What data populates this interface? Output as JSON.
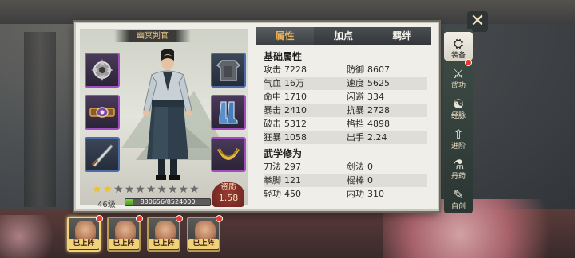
{
  "character": {
    "title": "幽冥判官",
    "level": "46级",
    "exp_text": "830656/8524000",
    "exp_fraction": 0.097,
    "stars_total": 10,
    "stars_on": 2,
    "aptitude_label": "资质",
    "aptitude_value": "1.58"
  },
  "tabs": [
    {
      "label": "属性",
      "active": true
    },
    {
      "label": "加点",
      "active": false
    },
    {
      "label": "羁绊",
      "active": false
    }
  ],
  "sections": {
    "basic_title": "基础属性",
    "martial_title": "武学修为"
  },
  "basic_stats": [
    {
      "l_name": "攻击",
      "l_value": "7228",
      "r_name": "防御",
      "r_value": "8607"
    },
    {
      "l_name": "气血",
      "l_value": "16万",
      "r_name": "速度",
      "r_value": "5625"
    },
    {
      "l_name": "命中",
      "l_value": "1710",
      "r_name": "闪避",
      "r_value": "334"
    },
    {
      "l_name": "暴击",
      "l_value": "2410",
      "r_name": "抗暴",
      "r_value": "2728"
    },
    {
      "l_name": "破击",
      "l_value": "5312",
      "r_name": "格挡",
      "r_value": "4898"
    },
    {
      "l_name": "狂暴",
      "l_value": "1058",
      "r_name": "出手",
      "r_value": "2.24"
    }
  ],
  "martial_stats": [
    {
      "l_name": "刀法",
      "l_value": "297",
      "r_name": "剑法",
      "r_value": "0"
    },
    {
      "l_name": "拳脚",
      "l_value": "121",
      "r_name": "棍棒",
      "r_value": "0"
    },
    {
      "l_name": "轻功",
      "l_value": "450",
      "r_name": "内功",
      "r_value": "310"
    }
  ],
  "side_menu": [
    {
      "label": "装备",
      "icon": "person-icon",
      "active": true,
      "dot": true
    },
    {
      "label": "武功",
      "icon": "martial-arts-icon",
      "active": false,
      "dot": false
    },
    {
      "label": "经脉",
      "icon": "meridian-icon",
      "active": false,
      "dot": false
    },
    {
      "label": "进阶",
      "icon": "advance-icon",
      "active": false,
      "dot": false
    },
    {
      "label": "丹药",
      "icon": "pill-icon",
      "active": false,
      "dot": false
    },
    {
      "label": "自创",
      "icon": "scroll-icon",
      "active": false,
      "dot": false
    }
  ],
  "team": [
    {
      "label": "已上阵",
      "dot": true
    },
    {
      "label": "已上阵",
      "dot": true
    },
    {
      "label": "已上阵",
      "dot": true
    },
    {
      "label": "已上阵",
      "dot": true
    }
  ],
  "close_icon": "close-icon",
  "colors": {
    "panel_bg": "#efeee9",
    "accent_gold": "#e8b25a",
    "exp_green": "#3f9a22",
    "slot_purple": "#a04ec0",
    "slot_blue": "#4c6ba8",
    "red_dot": "#e23b2d"
  }
}
